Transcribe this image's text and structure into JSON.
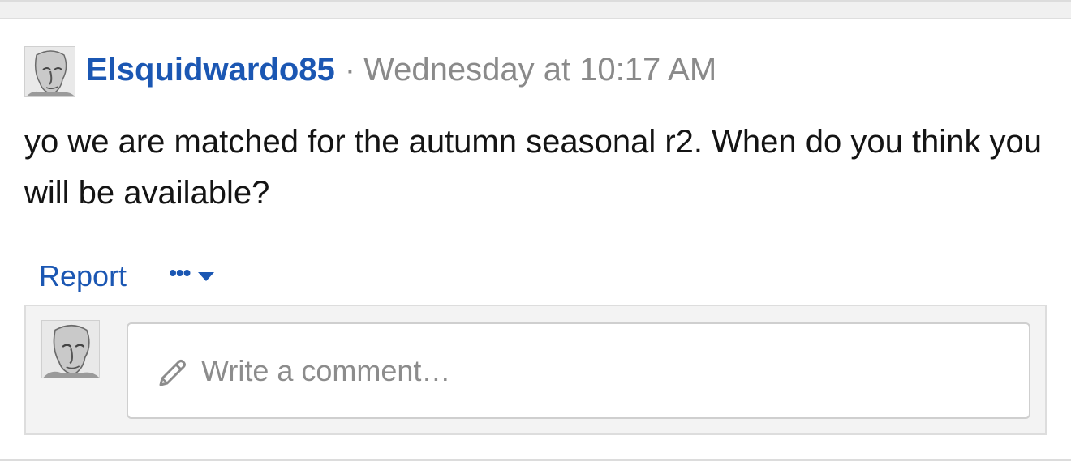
{
  "post": {
    "author": "Elsquidwardo85",
    "separator": "·",
    "timestamp": "Wednesday at 10:17 AM",
    "message": "yo we are matched for the autumn seasonal r2. When do you think you will be available?",
    "avatar_icon": "user-avatar-icon"
  },
  "actions": {
    "report_label": "Report",
    "more_label": "•••",
    "more_icon": "caret-down-icon"
  },
  "comment": {
    "placeholder": "Write a comment…",
    "input_icon": "pencil-icon"
  },
  "colors": {
    "link": "#1b57b3",
    "muted": "#8a8a8a",
    "text": "#141414"
  }
}
